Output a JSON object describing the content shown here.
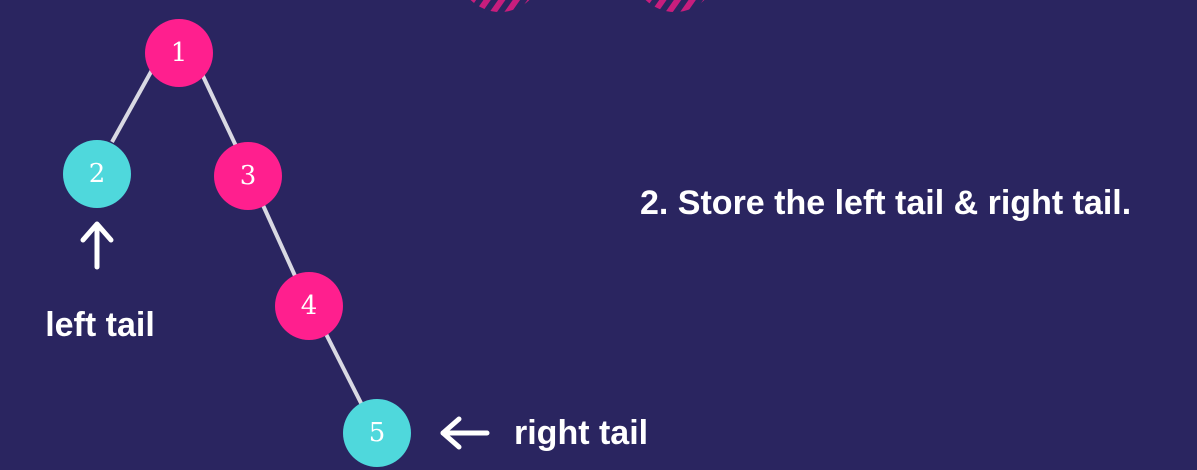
{
  "colors": {
    "background": "#2a2560",
    "node_pink": "#ff1f8e",
    "node_cyan": "#4fd8dc",
    "edge": "#d9d9e3",
    "text": "#ffffff",
    "decor_stripes": "#c81d7d"
  },
  "diagram": {
    "nodes": [
      {
        "id": "n1",
        "label": "1",
        "color": "pink"
      },
      {
        "id": "n2",
        "label": "2",
        "color": "cyan"
      },
      {
        "id": "n3",
        "label": "3",
        "color": "pink"
      },
      {
        "id": "n4",
        "label": "4",
        "color": "pink"
      },
      {
        "id": "n5",
        "label": "5",
        "color": "cyan"
      }
    ],
    "edges": [
      {
        "from": "n1",
        "to": "n2"
      },
      {
        "from": "n1",
        "to": "n3"
      },
      {
        "from": "n3",
        "to": "n4"
      },
      {
        "from": "n4",
        "to": "n5"
      }
    ],
    "left_tail_label": "left tail",
    "right_tail_label": "right tail",
    "arrow_up_icon": "arrow-up-icon",
    "arrow_left_icon": "arrow-left-icon"
  },
  "step_text": "2. Store the left tail & right tail."
}
